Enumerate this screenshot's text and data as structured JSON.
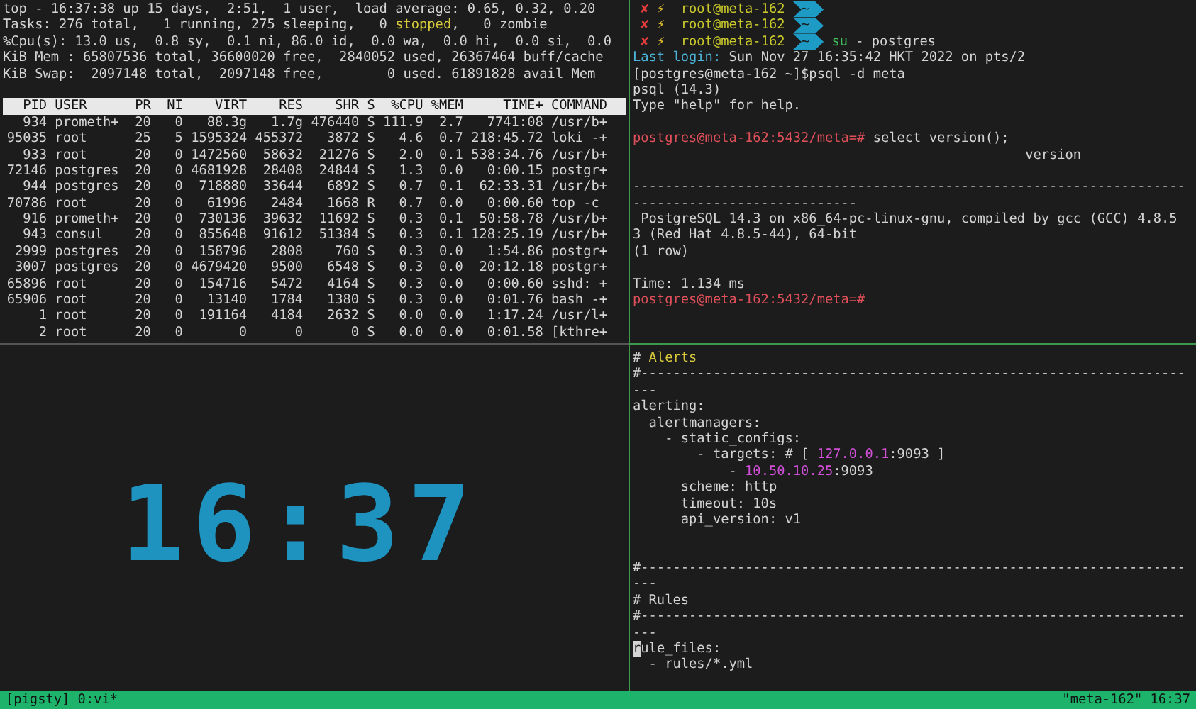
{
  "top_pane": {
    "summary": [
      [
        {
          "text": "top - 16:37:38 up 15 days,  2:51,  1 user,  load average: 0.65, 0.32, 0.20",
          "kind": "plain"
        }
      ],
      [
        {
          "text": "Tasks: 276 total,   1 running, 275 sleeping,   0 ",
          "kind": "plain"
        },
        {
          "text": "stopped",
          "kind": "warn"
        },
        {
          "text": ",   0 zombie",
          "kind": "plain"
        }
      ],
      [
        {
          "text": "%Cpu(s): 13.0 us,  0.8 sy,  0.1 ni, 86.0 id,  0.0 wa,  0.0 hi,  0.0 si,  0.0",
          "kind": "plain"
        }
      ],
      [
        {
          "text": "KiB Mem : 65807536 total, 36600020 free,  2840052 used, 26367464 buff/cache",
          "kind": "plain"
        }
      ],
      [
        {
          "text": "KiB Swap:  2097148 total,  2097148 free,        0 used. 61891828 avail Mem",
          "kind": "plain"
        }
      ]
    ],
    "table": {
      "columns": [
        "PID",
        "USER",
        "PR",
        "NI",
        "VIRT",
        "RES",
        "SHR",
        "S",
        "%CPU",
        "%MEM",
        "TIME+",
        "COMMAND"
      ],
      "rows": [
        [
          "934",
          "prometh+",
          "20",
          "0",
          "88.3g",
          "1.7g",
          "476440",
          "S",
          "111.9",
          "2.7",
          "7741:08",
          "/usr/b+"
        ],
        [
          "95035",
          "root",
          "25",
          "5",
          "1595324",
          "455372",
          "3872",
          "S",
          "4.6",
          "0.7",
          "218:45.72",
          "loki -+"
        ],
        [
          "933",
          "root",
          "20",
          "0",
          "1472560",
          "58632",
          "21276",
          "S",
          "2.0",
          "0.1",
          "538:34.76",
          "/usr/b+"
        ],
        [
          "72146",
          "postgres",
          "20",
          "0",
          "4681928",
          "28408",
          "24844",
          "S",
          "1.3",
          "0.0",
          "0:00.15",
          "postgr+"
        ],
        [
          "944",
          "postgres",
          "20",
          "0",
          "718880",
          "33644",
          "6892",
          "S",
          "0.7",
          "0.1",
          "62:33.31",
          "/usr/b+"
        ],
        [
          "70786",
          "root",
          "20",
          "0",
          "61996",
          "2484",
          "1668",
          "R",
          "0.7",
          "0.0",
          "0:00.60",
          "top -c"
        ],
        [
          "916",
          "prometh+",
          "20",
          "0",
          "730136",
          "39632",
          "11692",
          "S",
          "0.3",
          "0.1",
          "50:58.78",
          "/usr/b+"
        ],
        [
          "943",
          "consul",
          "20",
          "0",
          "855648",
          "91612",
          "51384",
          "S",
          "0.3",
          "0.1",
          "128:25.19",
          "/usr/b+"
        ],
        [
          "2999",
          "postgres",
          "20",
          "0",
          "158796",
          "2808",
          "760",
          "S",
          "0.3",
          "0.0",
          "1:54.86",
          "postgr+"
        ],
        [
          "3007",
          "postgres",
          "20",
          "0",
          "4679420",
          "9500",
          "6548",
          "S",
          "0.3",
          "0.0",
          "20:12.18",
          "postgr+"
        ],
        [
          "65896",
          "root",
          "20",
          "0",
          "154716",
          "5472",
          "4164",
          "S",
          "0.3",
          "0.0",
          "0:00.60",
          "sshd: +"
        ],
        [
          "65906",
          "root",
          "20",
          "0",
          "13140",
          "1784",
          "1380",
          "S",
          "0.3",
          "0.0",
          "0:01.76",
          "bash -+"
        ],
        [
          "1",
          "root",
          "20",
          "0",
          "191164",
          "4184",
          "2632",
          "S",
          "0.0",
          "0.0",
          "1:17.24",
          "/usr/l+"
        ],
        [
          "2",
          "root",
          "20",
          "0",
          "0",
          "0",
          "0",
          "S",
          "0.0",
          "0.0",
          "0:01.58",
          "[kthre+"
        ]
      ]
    }
  },
  "shell_pane": {
    "lines": [
      {
        "kind": "powerline",
        "status": "✘",
        "flag": "⚡",
        "user": "root@meta-162",
        "dir": "~"
      },
      {
        "kind": "powerline",
        "status": "✘",
        "flag": "⚡",
        "user": "root@meta-162",
        "dir": "~"
      },
      {
        "kind": "powerline",
        "status": "✘",
        "flag": "⚡",
        "user": "root@meta-162",
        "dir": "~",
        "command": "su",
        "args": "- postgres"
      },
      {
        "kind": "text",
        "segments": [
          {
            "text": "Last login:",
            "kind": "label"
          },
          {
            "text": " Sun Nov 27 16:35:42 HKT 2022 on pts/2",
            "kind": "plain"
          }
        ]
      },
      {
        "kind": "text",
        "segments": [
          {
            "text": "[postgres@meta-162 ~]$psql -d meta",
            "kind": "plain"
          }
        ]
      },
      {
        "kind": "text",
        "segments": [
          {
            "text": "psql (14.3)",
            "kind": "plain"
          }
        ]
      },
      {
        "kind": "text",
        "segments": [
          {
            "text": "Type \"help\" for help.",
            "kind": "plain"
          }
        ]
      },
      {
        "kind": "blank"
      },
      {
        "kind": "text",
        "segments": [
          {
            "text": "postgres@meta-162:5432/meta=#",
            "kind": "prompt"
          },
          {
            "text": " select version();",
            "kind": "plain"
          }
        ]
      },
      {
        "kind": "heading",
        "segments": [
          {
            "text": "version",
            "kind": "plain"
          }
        ]
      },
      {
        "kind": "blank"
      },
      {
        "kind": "text",
        "segments": [
          {
            "text": "---------------------------------------------------------------------",
            "kind": "plain"
          }
        ]
      },
      {
        "kind": "text",
        "segments": [
          {
            "text": "----------------------------",
            "kind": "plain"
          }
        ]
      },
      {
        "kind": "text",
        "segments": [
          {
            "text": " PostgreSQL 14.3 on x86_64-pc-linux-gnu, compiled by gcc (GCC) 4.8.5",
            "kind": "plain"
          }
        ]
      },
      {
        "kind": "text",
        "segments": [
          {
            "text": "3 (Red Hat 4.8.5-44), 64-bit",
            "kind": "plain"
          }
        ]
      },
      {
        "kind": "text",
        "segments": [
          {
            "text": "(1 row)",
            "kind": "plain"
          }
        ]
      },
      {
        "kind": "blank"
      },
      {
        "kind": "text",
        "segments": [
          {
            "text": "Time: 1.134 ms",
            "kind": "plain"
          }
        ]
      },
      {
        "kind": "text",
        "segments": [
          {
            "text": "postgres@meta-162:5432/meta=#",
            "kind": "prompt"
          }
        ]
      }
    ]
  },
  "clock_pane": {
    "time": "16:37"
  },
  "editor_pane": {
    "lines": [
      {
        "kind": "text",
        "segments": [
          {
            "text": "# ",
            "kind": "plain"
          },
          {
            "text": "Alerts",
            "kind": "warn"
          }
        ]
      },
      {
        "kind": "text",
        "segments": [
          {
            "text": "#--------------------------------------------------------------------",
            "kind": "plain"
          }
        ]
      },
      {
        "kind": "text",
        "segments": [
          {
            "text": "---",
            "kind": "plain"
          }
        ]
      },
      {
        "kind": "text",
        "segments": [
          {
            "text": "alerting:",
            "kind": "plain"
          }
        ]
      },
      {
        "kind": "text",
        "segments": [
          {
            "text": "  alertmanagers:",
            "kind": "plain"
          }
        ]
      },
      {
        "kind": "text",
        "segments": [
          {
            "text": "    - static_configs:",
            "kind": "plain"
          }
        ]
      },
      {
        "kind": "text",
        "segments": [
          {
            "text": "        - targets: # [ ",
            "kind": "plain"
          },
          {
            "text": "127.0.0.1",
            "kind": "number"
          },
          {
            "text": ":9093 ]",
            "kind": "plain"
          }
        ]
      },
      {
        "kind": "text",
        "segments": [
          {
            "text": "            - ",
            "kind": "plain"
          },
          {
            "text": "10.50.10.25",
            "kind": "number"
          },
          {
            "text": ":9093",
            "kind": "plain"
          }
        ]
      },
      {
        "kind": "text",
        "segments": [
          {
            "text": "      scheme: http",
            "kind": "plain"
          }
        ]
      },
      {
        "kind": "text",
        "segments": [
          {
            "text": "      timeout: 10s",
            "kind": "plain"
          }
        ]
      },
      {
        "kind": "text",
        "segments": [
          {
            "text": "      api_version: v1",
            "kind": "plain"
          }
        ]
      },
      {
        "kind": "blank"
      },
      {
        "kind": "blank"
      },
      {
        "kind": "text",
        "segments": [
          {
            "text": "#--------------------------------------------------------------------",
            "kind": "plain"
          }
        ]
      },
      {
        "kind": "text",
        "segments": [
          {
            "text": "---",
            "kind": "plain"
          }
        ]
      },
      {
        "kind": "text",
        "segments": [
          {
            "text": "# Rules",
            "kind": "plain"
          }
        ]
      },
      {
        "kind": "text",
        "segments": [
          {
            "text": "#--------------------------------------------------------------------",
            "kind": "plain"
          }
        ]
      },
      {
        "kind": "text",
        "segments": [
          {
            "text": "---",
            "kind": "plain"
          }
        ]
      },
      {
        "kind": "text",
        "segments": [
          {
            "text": "r",
            "kind": "cursor"
          },
          {
            "text": "ule_files:",
            "kind": "plain"
          }
        ]
      },
      {
        "kind": "text",
        "segments": [
          {
            "text": "  - rules/*.yml",
            "kind": "plain"
          }
        ]
      }
    ]
  },
  "status_bar": {
    "session": "[pigsty] 0:vi*",
    "host": "\"meta-162\"",
    "time": "16:37"
  }
}
